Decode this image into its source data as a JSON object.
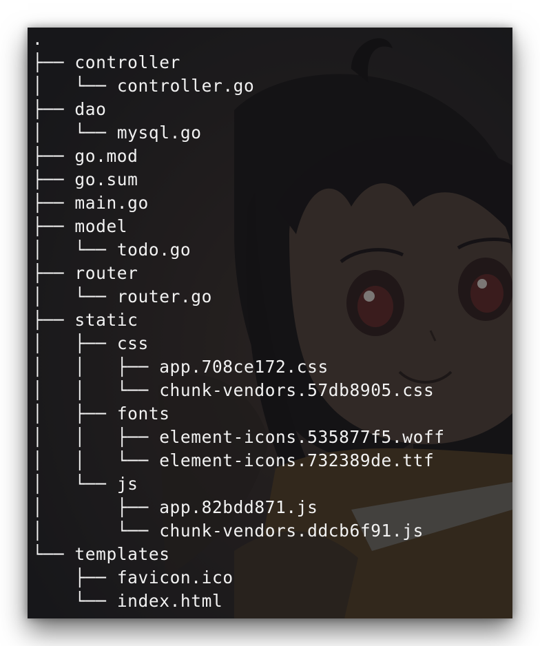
{
  "terminal": {
    "root": ".",
    "lines": [
      {
        "prefix": "├── ",
        "name": "controller"
      },
      {
        "prefix": "│   └── ",
        "name": "controller.go"
      },
      {
        "prefix": "├── ",
        "name": "dao"
      },
      {
        "prefix": "│   └── ",
        "name": "mysql.go"
      },
      {
        "prefix": "├── ",
        "name": "go.mod"
      },
      {
        "prefix": "├── ",
        "name": "go.sum"
      },
      {
        "prefix": "├── ",
        "name": "main.go"
      },
      {
        "prefix": "├── ",
        "name": "model"
      },
      {
        "prefix": "│   └── ",
        "name": "todo.go"
      },
      {
        "prefix": "├── ",
        "name": "router"
      },
      {
        "prefix": "│   └── ",
        "name": "router.go"
      },
      {
        "prefix": "├── ",
        "name": "static"
      },
      {
        "prefix": "│   ├── ",
        "name": "css"
      },
      {
        "prefix": "│   │   ├── ",
        "name": "app.708ce172.css"
      },
      {
        "prefix": "│   │   └── ",
        "name": "chunk-vendors.57db8905.css"
      },
      {
        "prefix": "│   ├── ",
        "name": "fonts"
      },
      {
        "prefix": "│   │   ├── ",
        "name": "element-icons.535877f5.woff"
      },
      {
        "prefix": "│   │   └── ",
        "name": "element-icons.732389de.ttf"
      },
      {
        "prefix": "│   └── ",
        "name": "js"
      },
      {
        "prefix": "│       ├── ",
        "name": "app.82bdd871.js"
      },
      {
        "prefix": "│       └── ",
        "name": "chunk-vendors.ddcb6f91.js"
      },
      {
        "prefix": "└── ",
        "name": "templates"
      },
      {
        "prefix": "    ├── ",
        "name": "favicon.ico"
      },
      {
        "prefix": "    └── ",
        "name": "index.html"
      }
    ]
  },
  "colors": {
    "text": "#f2f2f2",
    "background": "#1e1e21"
  }
}
